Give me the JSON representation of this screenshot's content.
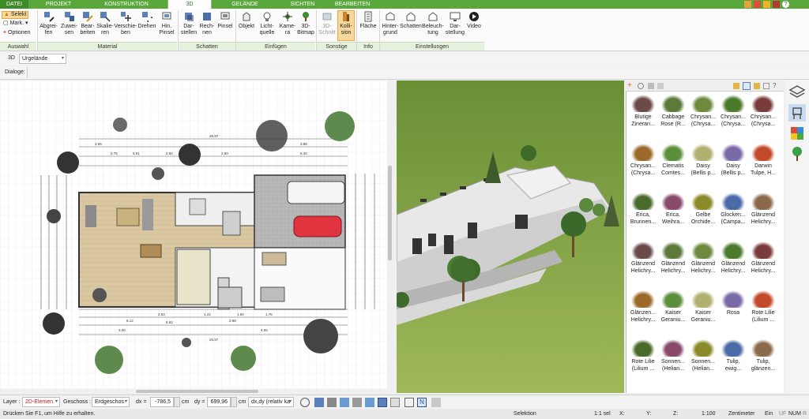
{
  "tabs": [
    "DATEI",
    "PROJEKT",
    "KONSTRUKTION",
    "3D",
    "GELÄNDE",
    "SICHTEN",
    "BEARBEITEN"
  ],
  "ribbon": {
    "auswahl": {
      "select": "Selekt",
      "mark": "Mark.",
      "options": "Optionen"
    },
    "material": [
      "Abgrei-\nfen",
      "Zuwei-\nsen",
      "Bear-\nbeiten",
      "Skalie-\nren",
      "Verschie-\nben",
      "Drehen",
      "Hin.\nPinsel"
    ],
    "schatten": [
      "Dar-\nstellen",
      "Rech-\nnen",
      "Pinsel"
    ],
    "einfuegen": [
      "Objekt",
      "Licht-\nquelle",
      "Kame-\nra",
      "3D-\nBitmap"
    ],
    "sonstige": [
      "3D-\nSchnitt",
      "Kolli-\nsion"
    ],
    "info": [
      "Fläche"
    ],
    "einstellungen": [
      "Hinter-\ngrund",
      "Schatten",
      "Beleuch-\ntung",
      "Dar-\nstellung",
      "Video"
    ],
    "groups": [
      "Auswahl",
      "Material",
      "Schatten",
      "Einfügen",
      "Sonstige",
      "Info",
      "Einstellungen"
    ]
  },
  "toolbar": {
    "mode": "3D",
    "terrain": "Urgelände",
    "dialoge": "Dialoge:"
  },
  "catalog": {
    "items": [
      "Blutige\nZinerari...",
      "Cabbage\nRose (R...",
      "Chrysan...\n(Chrysa...",
      "Chrysan...\n(Chrysa...",
      "Chrysan...\n(Chrysa...",
      "Chrysan...\n(Chrysa...",
      "Clematis\nComtes...",
      "Daisy\n(Bellis p...",
      "Daisy\n(Bellis p...",
      "Darwin\nTulpe, H...",
      "Erica,\nBrunnen...",
      "Erica,\nWeihra...",
      "Gelbe\nOrchide...",
      "Glocken...\n(Campa...",
      "Glänzend\nHelichry...",
      "Glänzend\nHelichry...",
      "Glänzend\nHelichry...",
      "Glänzend\nHelichry...",
      "Glänzend\nHelichry...",
      "Glänzend\nHelichry...",
      "Glänzen...\nHelichry...",
      "Kaiser\nGeraniu...",
      "Kaiser\nGeraniu...",
      "Rosa",
      "Rote Lilie\n(Lilium ...",
      "Rote Lilie\n(Lilium ...",
      "Sonnen...\n(Helian...",
      "Sonnen...\n(Helian...",
      "Tulip,\newig...",
      "Tulip,\nglänzen..."
    ]
  },
  "plan_dims": [
    "25.97",
    "3.65",
    "5.01",
    "0.76",
    "2.60",
    "1.64",
    "2.60",
    "6.40",
    "6.12",
    "8.62",
    "3.00",
    "4.05",
    "3.86",
    "2.98",
    "2.93",
    "1.24",
    "1.50",
    "1.75"
  ],
  "bottom": {
    "layer_label": "Layer :",
    "layer_value": "2D-Elemen",
    "geschoss_label": "Geschoss :",
    "geschoss_value": "Erdgeschos",
    "dx_label": "dx =",
    "dx_value": "-786,5",
    "dy_label": "dy =",
    "dy_value": "699,96",
    "unit": "cm",
    "mode": "dx,dy (relativ ka"
  },
  "status": {
    "help": "Drücken Sie F1, um Hilfe zu erhalten.",
    "mode": "Selektion",
    "scale": "1:1 sel",
    "x": "X:",
    "y": "Y:",
    "z": "Z:",
    "ratio": "1:100",
    "unit": "Zentimeter",
    "ein": "Ein",
    "uf": "UF",
    "num": "NUM",
    "r": "R"
  }
}
